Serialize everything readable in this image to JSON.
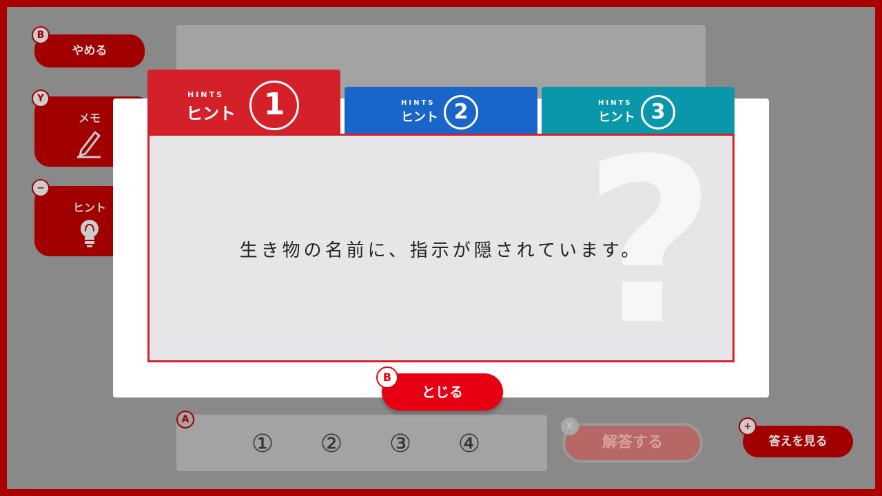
{
  "menu": {
    "quit": {
      "badge": "B",
      "label": "やめる"
    },
    "memo": {
      "badge": "Y",
      "label": "メモ",
      "icon": "pencil-icon"
    },
    "hint": {
      "badge": "−",
      "label": "ヒント",
      "icon": "lightbulb-icon"
    }
  },
  "answer": {
    "badge": "A",
    "choices": [
      "①",
      "②",
      "③",
      "④"
    ],
    "solve": {
      "badge": "X",
      "label": "解答する"
    },
    "see_answer": {
      "badge": "+",
      "label": "答えを見る"
    }
  },
  "hint_modal": {
    "tabs": [
      {
        "small": "HINTS",
        "label": "ヒント",
        "number": "1",
        "color": "#d42129"
      },
      {
        "small": "HINTS",
        "label": "ヒント",
        "number": "2",
        "color": "#1a65c9"
      },
      {
        "small": "HINTS",
        "label": "ヒント",
        "number": "3",
        "color": "#0b97aa"
      }
    ],
    "text": "生き物の名前に、指示が隠されています。",
    "watermark": "?",
    "close": {
      "badge": "B",
      "label": "とじる"
    }
  }
}
